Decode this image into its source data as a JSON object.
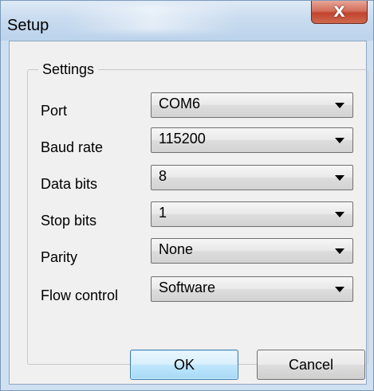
{
  "window": {
    "title": "Setup",
    "close_glyph": "X"
  },
  "settings": {
    "group_label": "Settings",
    "fields": [
      {
        "label": "Port",
        "value": "COM6"
      },
      {
        "label": "Baud rate",
        "value": "115200"
      },
      {
        "label": "Data bits",
        "value": "8"
      },
      {
        "label": "Stop bits",
        "value": "1"
      },
      {
        "label": "Parity",
        "value": "None"
      },
      {
        "label": "Flow control",
        "value": "Software"
      }
    ]
  },
  "buttons": {
    "ok_label": "OK",
    "cancel_label": "Cancel"
  },
  "icons": {
    "close": "close-icon",
    "dropdown": "chevron-down-icon"
  },
  "colors": {
    "titlebar": "#c8dbef",
    "close_button": "#c1432d",
    "default_button_border": "#3c7fb1"
  }
}
